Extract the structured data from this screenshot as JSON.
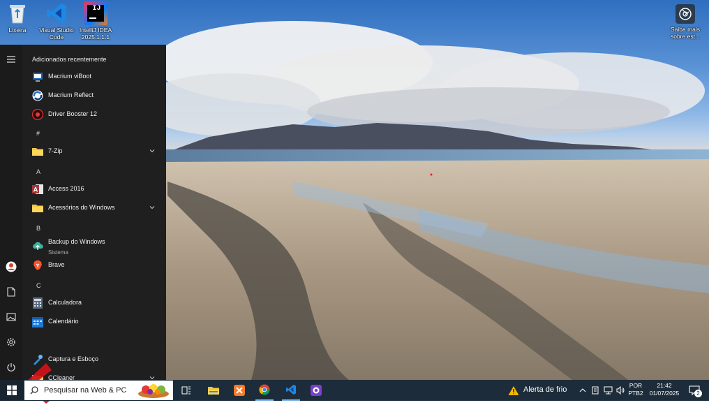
{
  "desktop": {
    "icons": [
      {
        "label": "Lixeira",
        "icon": "recycle-bin-icon"
      },
      {
        "label": "Visual Studio Code",
        "icon": "vscode-icon"
      },
      {
        "label": "IntelliJ IDEA 2025.1.1.1",
        "icon": "intellij-icon"
      }
    ],
    "learn_more": {
      "label": "Saiba mais sobre est...",
      "icon": "camera-icon"
    }
  },
  "start_menu": {
    "rail": [
      {
        "name": "hamburger-menu-icon"
      },
      {
        "name": "user-avatar"
      },
      {
        "name": "documents-icon"
      },
      {
        "name": "pictures-icon"
      },
      {
        "name": "settings-icon"
      },
      {
        "name": "power-icon"
      }
    ],
    "recent_title": "Adicionados recentemente",
    "recent": [
      {
        "label": "Macrium viBoot",
        "icon": "macrium-viboot-icon"
      },
      {
        "label": "Macrium Reflect",
        "icon": "macrium-reflect-icon"
      },
      {
        "label": "Driver Booster 12",
        "icon": "driver-booster-icon"
      }
    ],
    "groups": [
      {
        "letter": "#",
        "items": [
          {
            "label": "7-Zip",
            "icon": "folder-icon",
            "expandable": true
          }
        ]
      },
      {
        "letter": "A",
        "items": [
          {
            "label": "Access 2016",
            "icon": "access-icon"
          },
          {
            "label": "Acessórios do Windows",
            "icon": "folder-icon",
            "expandable": true
          }
        ]
      },
      {
        "letter": "B",
        "items": [
          {
            "label": "Backup do Windows",
            "sub": "Sistema",
            "icon": "backup-icon"
          },
          {
            "label": "Brave",
            "icon": "brave-icon"
          }
        ]
      },
      {
        "letter": "C",
        "items": [
          {
            "label": "Calculadora",
            "icon": "calculator-icon"
          },
          {
            "label": "Calendário",
            "icon": "calendar-icon"
          },
          {
            "label": "Captura e Esboço",
            "icon": "snip-sketch-icon"
          },
          {
            "label": "CCleaner",
            "icon": "folder-icon",
            "expandable": true
          }
        ]
      }
    ]
  },
  "taskbar": {
    "search_placeholder": "Pesquisar na Web & PC",
    "pinned": [
      "task-view-icon",
      "file-explorer-icon",
      "xampp-icon",
      "chrome-icon",
      "vscode-icon",
      "github-desktop-icon"
    ],
    "weather": "Alerta de frio",
    "lang_line1": "POR",
    "lang_line2": "PTB2",
    "time": "21:42",
    "date": "01/07/2025",
    "notification_count": "2"
  },
  "colors": {
    "accent": "#0078d4",
    "start_bg": "#1f1f1f",
    "taskbar_bg": "#1d2c3a",
    "arrow": "#d0121a"
  }
}
